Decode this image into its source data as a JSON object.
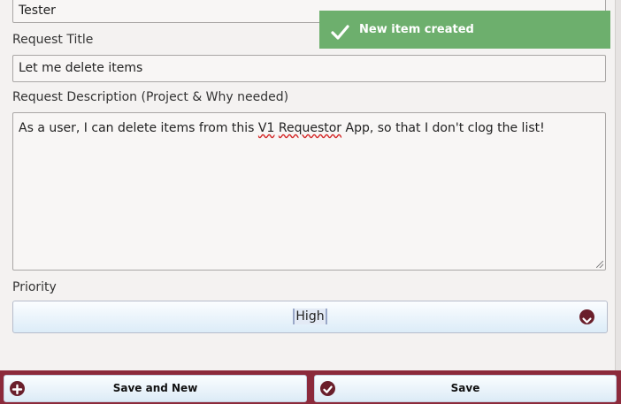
{
  "form": {
    "requester_value": "Tester",
    "title_label": "Request Title",
    "title_value": "Let me delete items",
    "description_label": "Request Description (Project & Why needed)",
    "description_before": "As a user, I can delete items from this ",
    "description_misspelled_1": "V1",
    "description_space": " ",
    "description_misspelled_2": "Requestor",
    "description_after": " App, so that I don't clog the list!",
    "priority_label": "Priority",
    "priority_value": "High"
  },
  "toast": {
    "message": "New item created",
    "color": "#6daf6d"
  },
  "footer": {
    "save_and_new_label": "Save and New",
    "save_label": "Save",
    "bar_color": "#8c2a3b",
    "icon_color": "#6a1f2b"
  },
  "icons": {
    "toast": "checkmark-icon",
    "priority": "chevron-down-circle-icon",
    "save_and_new": "plus-circle-icon",
    "save": "check-circle-icon"
  }
}
